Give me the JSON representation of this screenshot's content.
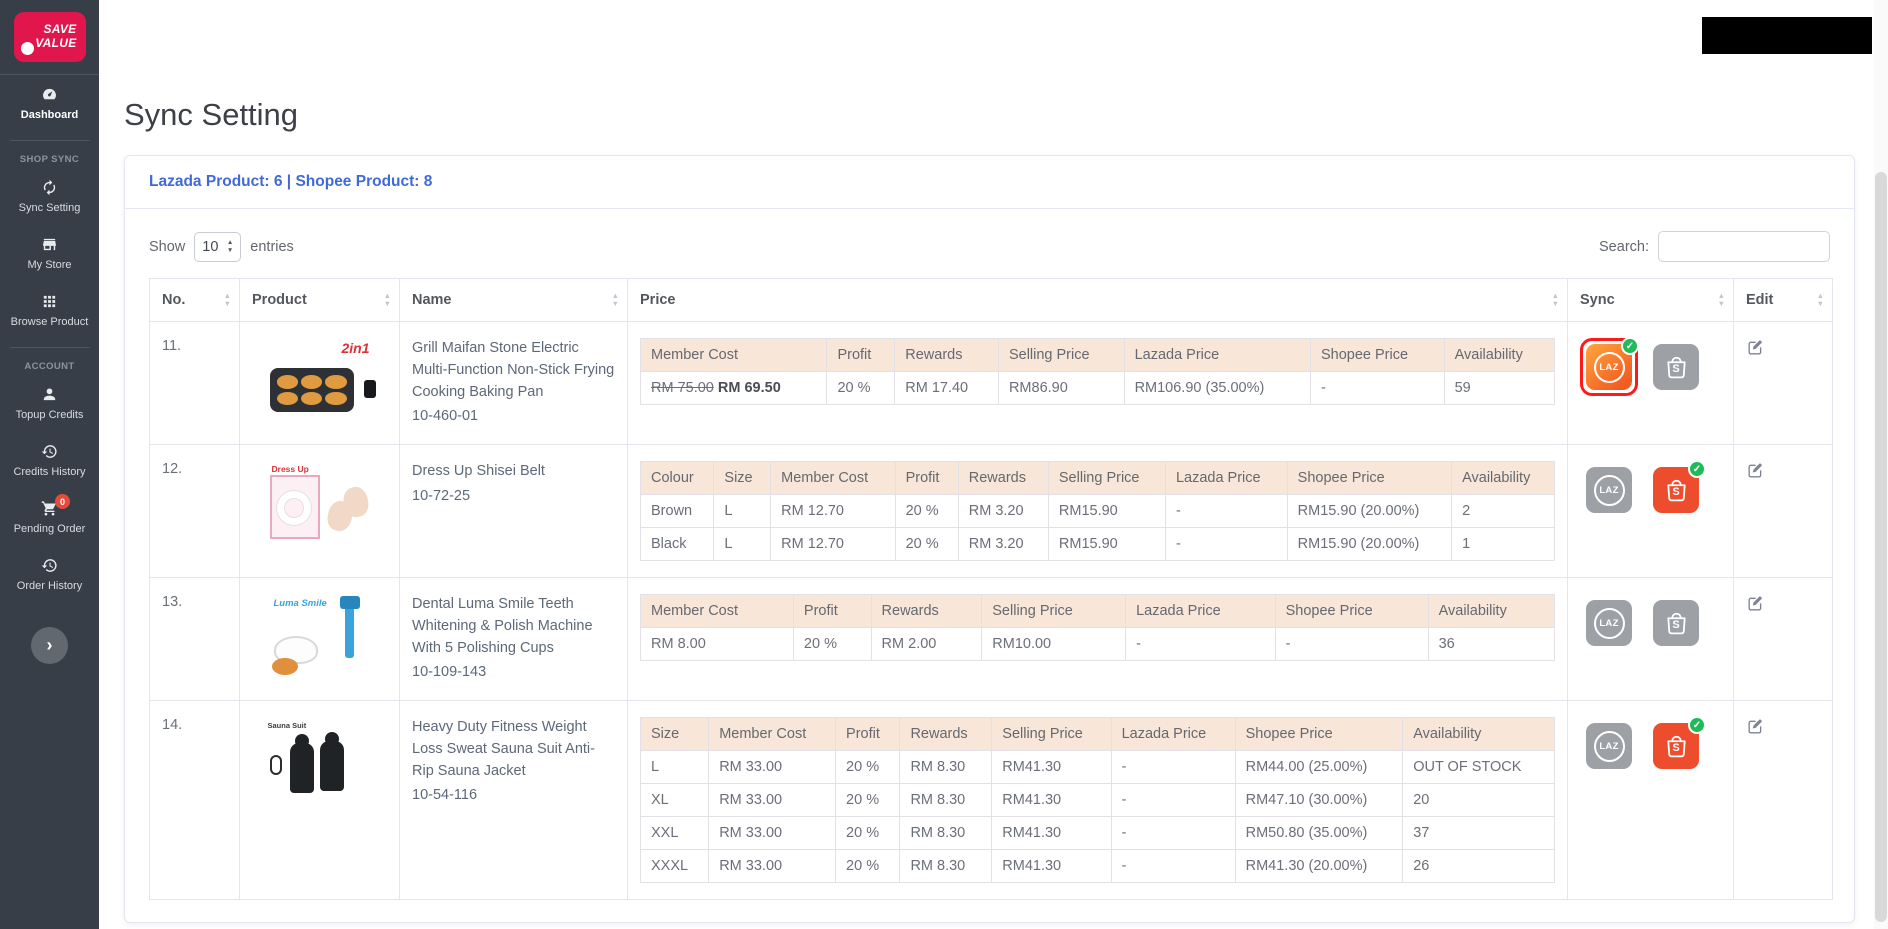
{
  "brand": {
    "line1": "SAVE",
    "line2": "VALUE"
  },
  "page": {
    "title": "Sync Setting"
  },
  "sidebar": {
    "collapse_glyph": "›",
    "items": [
      {
        "type": "link",
        "id": "dashboard",
        "label": "Dashboard",
        "icon": "dashboard-icon",
        "active": true
      },
      {
        "type": "heading",
        "label": "SHOP SYNC"
      },
      {
        "type": "link",
        "id": "sync-setting",
        "label": "Sync Setting",
        "icon": "sync-icon"
      },
      {
        "type": "link",
        "id": "my-store",
        "label": "My Store",
        "icon": "store-icon"
      },
      {
        "type": "link",
        "id": "browse-product",
        "label": "Browse Product",
        "icon": "grid-icon"
      },
      {
        "type": "heading",
        "label": "ACCOUNT"
      },
      {
        "type": "link",
        "id": "topup-credits",
        "label": "Topup Credits",
        "icon": "user-icon"
      },
      {
        "type": "link",
        "id": "credits-history",
        "label": "Credits History",
        "icon": "history-icon"
      },
      {
        "type": "link",
        "id": "pending-order",
        "label": "Pending Order",
        "icon": "cart-icon",
        "badge": "0"
      },
      {
        "type": "link",
        "id": "order-history",
        "label": "Order History",
        "icon": "history-icon"
      }
    ]
  },
  "card": {
    "header": "Lazada Product: 6 | Shopee Product: 8"
  },
  "controls": {
    "show_label": "Show",
    "page_size": "10",
    "entries_label": "entries",
    "search_label": "Search:",
    "search_value": ""
  },
  "icons": {
    "lazada_text": "LAZ",
    "shopee_letter": "S",
    "check_glyph": "✓",
    "sort_up": "▲",
    "sort_down": "▼"
  },
  "colors": {
    "accent_blue": "#3f6ad8",
    "sidebar_bg": "#373e47",
    "lazada_orange": "#f5731f",
    "shopee_orange": "#ee4d2d",
    "inactive_gray": "#9da0a5",
    "success_green": "#21ba58",
    "highlight_red": "#ff1a1a",
    "price_header_bg": "#f8e6d9",
    "badge_red": "#e74a3b",
    "brand_red": "#e0164c"
  },
  "table": {
    "columns": [
      "No.",
      "Product",
      "Name",
      "Price",
      "Sync",
      "Edit"
    ],
    "rows": [
      {
        "no": "11.",
        "image": {
          "type": "grill",
          "caption": "2in1"
        },
        "name": "Grill Maifan Stone Electric Multi-Function Non-Stick Frying Cooking Baking Pan",
        "sku": "10-460-01",
        "price": {
          "headers": [
            "Member Cost",
            "Profit",
            "Rewards",
            "Selling Price",
            "Lazada Price",
            "Shopee Price",
            "Availability"
          ],
          "rows": [
            [
              {
                "old": "RM 75.00",
                "text": "RM 69.50"
              },
              "20 %",
              "RM 17.40",
              "RM86.90",
              "RM106.90 (35.00%)",
              "-",
              "59"
            ]
          ]
        },
        "sync": {
          "lazada": {
            "active": true,
            "checked": true,
            "highlighted": true
          },
          "shopee": {
            "active": false,
            "checked": false
          }
        }
      },
      {
        "no": "12.",
        "image": {
          "type": "belt",
          "caption": "Dress Up"
        },
        "name": "Dress Up Shisei Belt",
        "sku": "10-72-25",
        "price": {
          "headers": [
            "Colour",
            "Size",
            "Member Cost",
            "Profit",
            "Rewards",
            "Selling Price",
            "Lazada Price",
            "Shopee Price",
            "Availability"
          ],
          "rows": [
            [
              "Brown",
              "L",
              "RM 12.70",
              "20 %",
              "RM 3.20",
              "RM15.90",
              "-",
              "RM15.90 (20.00%)",
              "2"
            ],
            [
              "Black",
              "L",
              "RM 12.70",
              "20 %",
              "RM 3.20",
              "RM15.90",
              "-",
              "RM15.90 (20.00%)",
              "1"
            ]
          ]
        },
        "sync": {
          "lazada": {
            "active": false,
            "checked": false
          },
          "shopee": {
            "active": true,
            "checked": true
          }
        }
      },
      {
        "no": "13.",
        "image": {
          "type": "teeth",
          "caption": "Luma Smile"
        },
        "name": "Dental Luma Smile Teeth Whitening & Polish Machine With 5 Polishing Cups",
        "sku": "10-109-143",
        "price": {
          "headers": [
            "Member Cost",
            "Profit",
            "Rewards",
            "Selling Price",
            "Lazada Price",
            "Shopee Price",
            "Availability"
          ],
          "rows": [
            [
              "RM 8.00",
              "20 %",
              "RM 2.00",
              "RM10.00",
              "-",
              "-",
              "36"
            ]
          ]
        },
        "sync": {
          "lazada": {
            "active": false,
            "checked": false
          },
          "shopee": {
            "active": false,
            "checked": false
          }
        }
      },
      {
        "no": "14.",
        "image": {
          "type": "sauna",
          "caption": "Sauna Suit"
        },
        "name": "Heavy Duty Fitness Weight Loss Sweat Sauna Suit Anti-Rip Sauna Jacket",
        "sku": "10-54-116",
        "price": {
          "headers": [
            "Size",
            "Member Cost",
            "Profit",
            "Rewards",
            "Selling Price",
            "Lazada Price",
            "Shopee Price",
            "Availability"
          ],
          "rows": [
            [
              "L",
              "RM 33.00",
              "20 %",
              "RM 8.30",
              "RM41.30",
              "-",
              "RM44.00 (25.00%)",
              "OUT OF STOCK"
            ],
            [
              "XL",
              "RM 33.00",
              "20 %",
              "RM 8.30",
              "RM41.30",
              "-",
              "RM47.10 (30.00%)",
              "20"
            ],
            [
              "XXL",
              "RM 33.00",
              "20 %",
              "RM 8.30",
              "RM41.30",
              "-",
              "RM50.80 (35.00%)",
              "37"
            ],
            [
              "XXXL",
              "RM 33.00",
              "20 %",
              "RM 8.30",
              "RM41.30",
              "-",
              "RM41.30 (20.00%)",
              "26"
            ]
          ]
        },
        "sync": {
          "lazada": {
            "active": false,
            "checked": false
          },
          "shopee": {
            "active": true,
            "checked": true
          }
        }
      }
    ]
  }
}
